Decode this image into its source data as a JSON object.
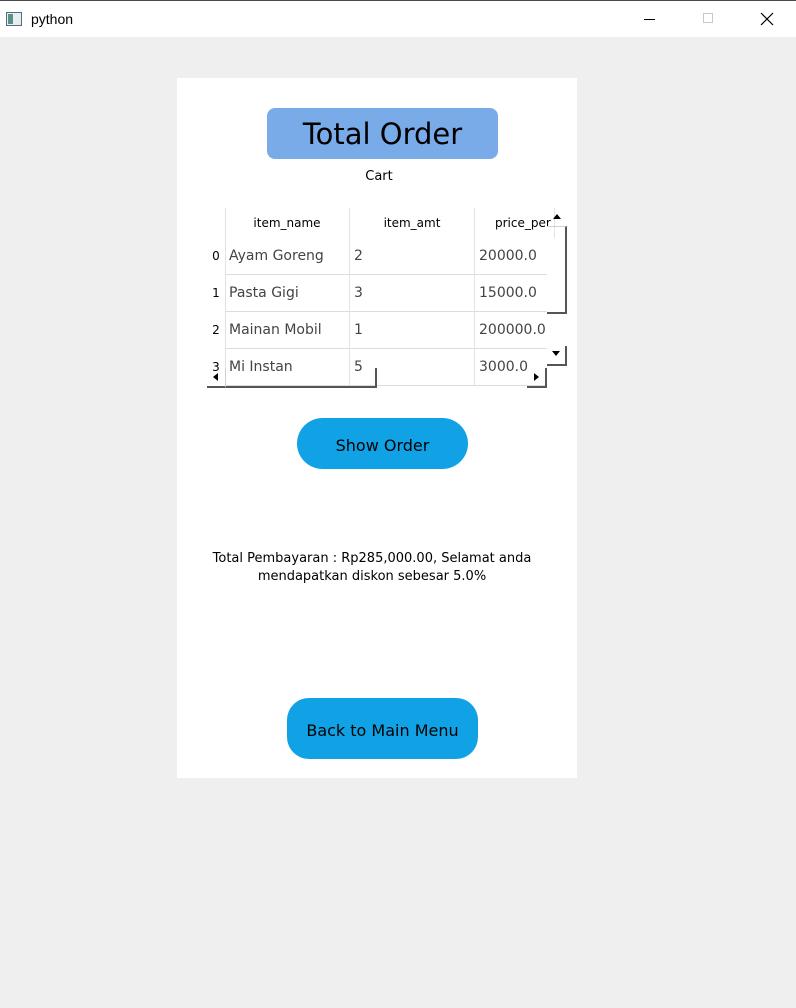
{
  "window": {
    "title": "python"
  },
  "panel": {
    "heading": "Total Order",
    "cart_label": "Cart",
    "table": {
      "columns": [
        "item_name",
        "item_amt",
        "price_per"
      ],
      "rows": [
        {
          "index": "0",
          "item_name": "Ayam Goreng",
          "item_amt": "2",
          "price_per": "20000.0"
        },
        {
          "index": "1",
          "item_name": "Pasta Gigi",
          "item_amt": "3",
          "price_per": "15000.0"
        },
        {
          "index": "2",
          "item_name": "Mainan Mobil",
          "item_amt": "1",
          "price_per": "200000.0"
        },
        {
          "index": "3",
          "item_name": "Mi Instan",
          "item_amt": "5",
          "price_per": "3000.0"
        }
      ]
    },
    "show_order_label": "Show Order",
    "total_line1": "Total Pembayaran : Rp285,000.00, Selamat anda",
    "total_line2": "mendapatkan diskon sebesar 5.0%",
    "back_label": "Back to Main Menu"
  }
}
